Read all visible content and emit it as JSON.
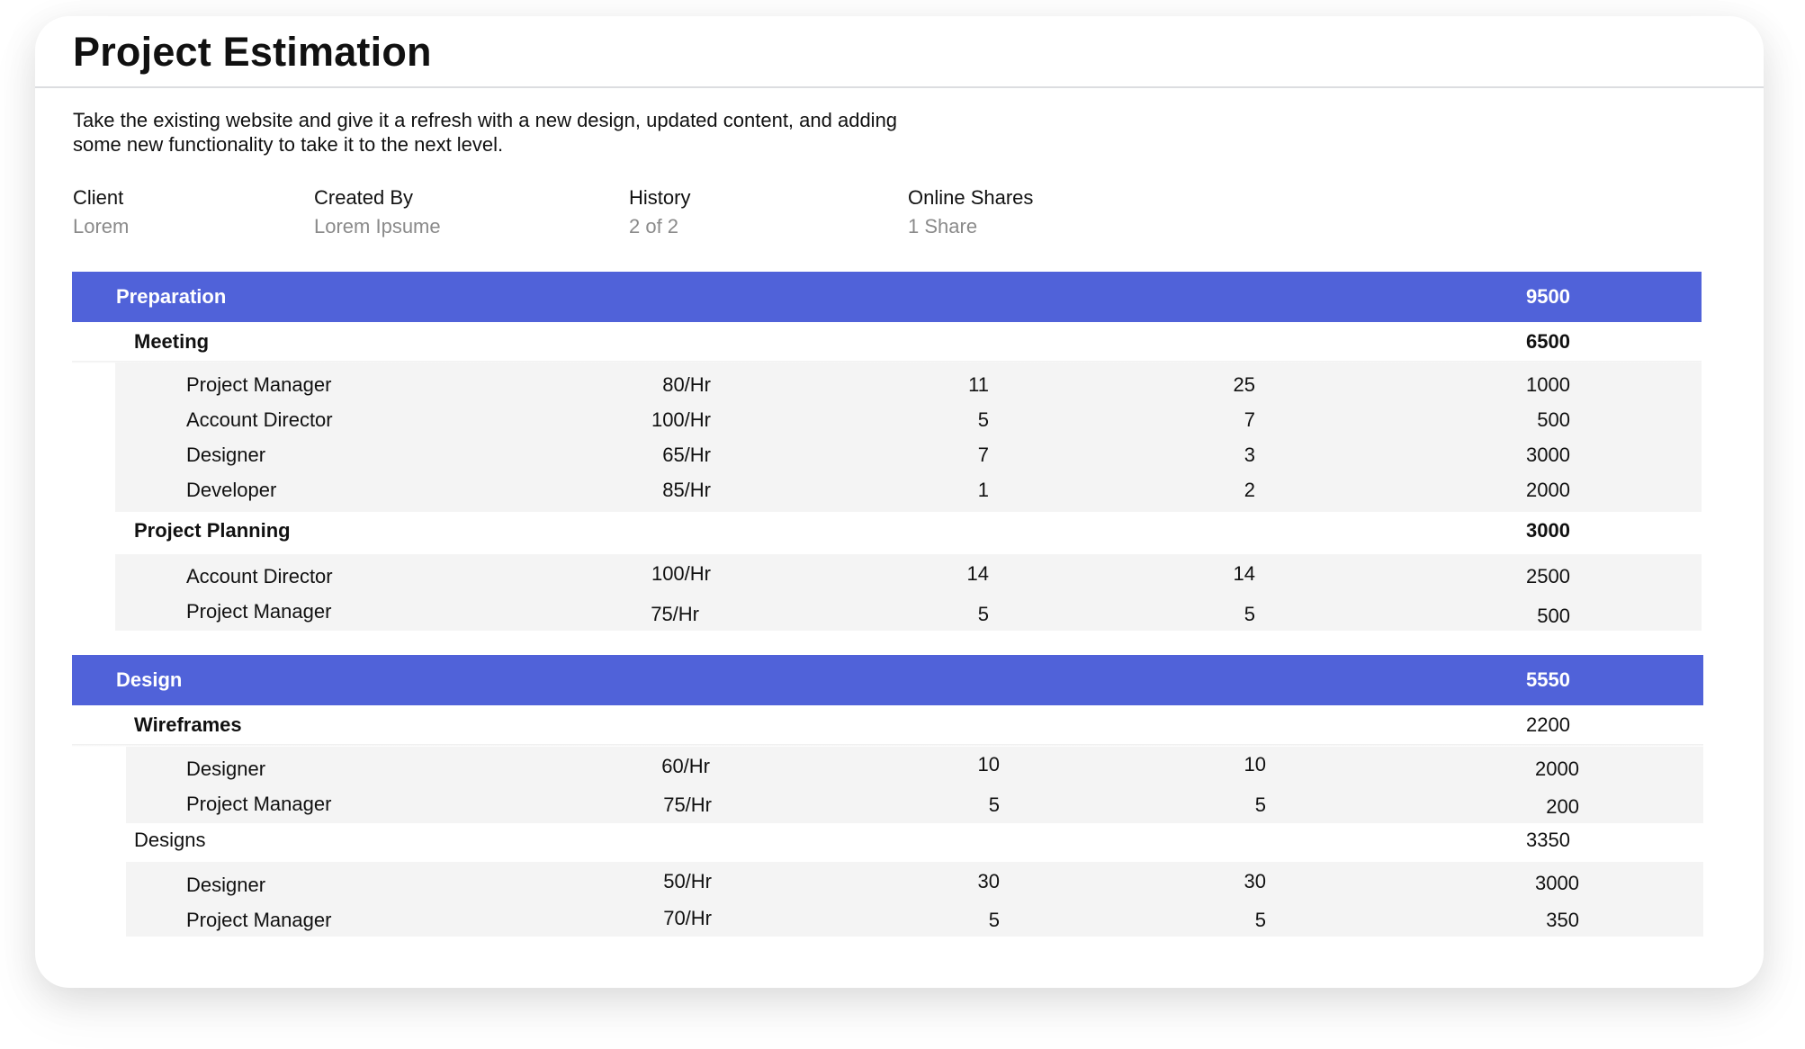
{
  "title": "Project Estimation",
  "description": "Take the existing website and give it a refresh with a new design, updated content, and adding some new functionality to take it to the next level.",
  "meta": {
    "client": {
      "label": "Client",
      "value": "Lorem"
    },
    "created_by": {
      "label": "Created By",
      "value": "Lorem Ipsume"
    },
    "history": {
      "label": "History",
      "value": "2 of 2"
    },
    "online_shares": {
      "label": "Online Shares",
      "value": "1 Share"
    }
  },
  "sections": [
    {
      "name": "Preparation",
      "total": "9500",
      "groups": [
        {
          "name": "Meeting",
          "total": "6500",
          "rows": [
            {
              "role": "Project Manager",
              "rate": "80/Hr",
              "a": "11",
              "b": "25",
              "amount": "1000"
            },
            {
              "role": "Account Director",
              "rate": "100/Hr",
              "a": "5",
              "b": "7",
              "amount": "500"
            },
            {
              "role": "Designer",
              "rate": "65/Hr",
              "a": "7",
              "b": "3",
              "amount": "3000"
            },
            {
              "role": "Developer",
              "rate": "85/Hr",
              "a": "1",
              "b": "2",
              "amount": "2000"
            }
          ]
        },
        {
          "name": "Project Planning",
          "total": "3000",
          "rows": [
            {
              "role": "Account Director",
              "rate": "100/Hr",
              "a": "14",
              "b": "14",
              "amount": "2500"
            },
            {
              "role": "Project Manager",
              "rate": "75/Hr",
              "a": "5",
              "b": "5",
              "amount": "500"
            }
          ]
        }
      ]
    },
    {
      "name": "Design",
      "total": "5550",
      "groups": [
        {
          "name": "Wireframes",
          "total": "2200",
          "rows": [
            {
              "role": "Designer",
              "rate": "60/Hr",
              "a": "10",
              "b": "10",
              "amount": "2000"
            },
            {
              "role": "Project Manager",
              "rate": "75/Hr",
              "a": "5",
              "b": "5",
              "amount": "200"
            }
          ]
        },
        {
          "name": "Designs",
          "total": "3350",
          "rows": [
            {
              "role": "Designer",
              "rate": "50/Hr",
              "a": "30",
              "b": "30",
              "amount": "3000"
            },
            {
              "role": "Project Manager",
              "rate": "70/Hr",
              "a": "5",
              "b": "5",
              "amount": "350"
            }
          ]
        }
      ]
    }
  ]
}
